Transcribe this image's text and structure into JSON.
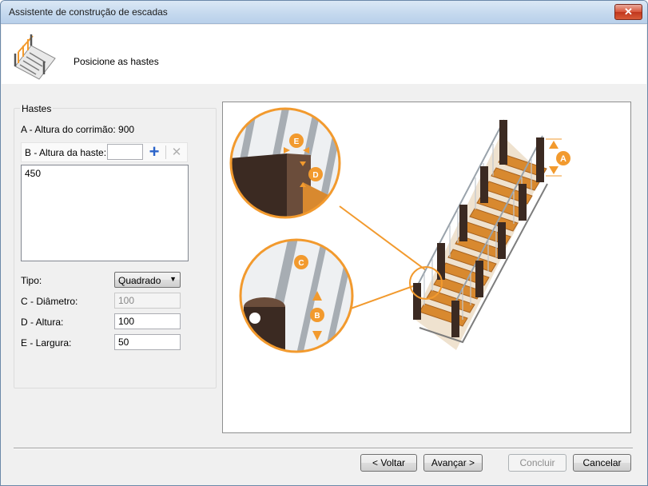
{
  "window": {
    "title": "Assistente de construção de escadas",
    "close_glyph": "✕"
  },
  "header": {
    "title": "Posicione as hastes",
    "icon": "stair-railing-icon"
  },
  "group": {
    "title": "Hastes",
    "handrail_height_label": "A - Altura do corrimão: 900",
    "rod_height_label": "B - Altura da haste:",
    "rod_height_value": "",
    "add_glyph": "+",
    "delete_glyph": "✕",
    "list_items": [
      "450"
    ],
    "type_label": "Tipo:",
    "type_value": "Quadrado",
    "diameter_label": "C - Diâmetro:",
    "diameter_value": "100",
    "height_label": "D - Altura:",
    "height_value": "100",
    "width_label": "E - Largura:",
    "width_value": "50"
  },
  "diagram": {
    "markers": [
      "A",
      "B",
      "C",
      "D",
      "E"
    ],
    "colors": {
      "accent": "#f29a2e",
      "wood": "#d8892f",
      "post": "#3b2a22",
      "metal": "#b9bfc6"
    }
  },
  "footer": {
    "back_label": "< Voltar",
    "next_label": "Avançar >",
    "finish_label": "Concluir",
    "cancel_label": "Cancelar"
  }
}
